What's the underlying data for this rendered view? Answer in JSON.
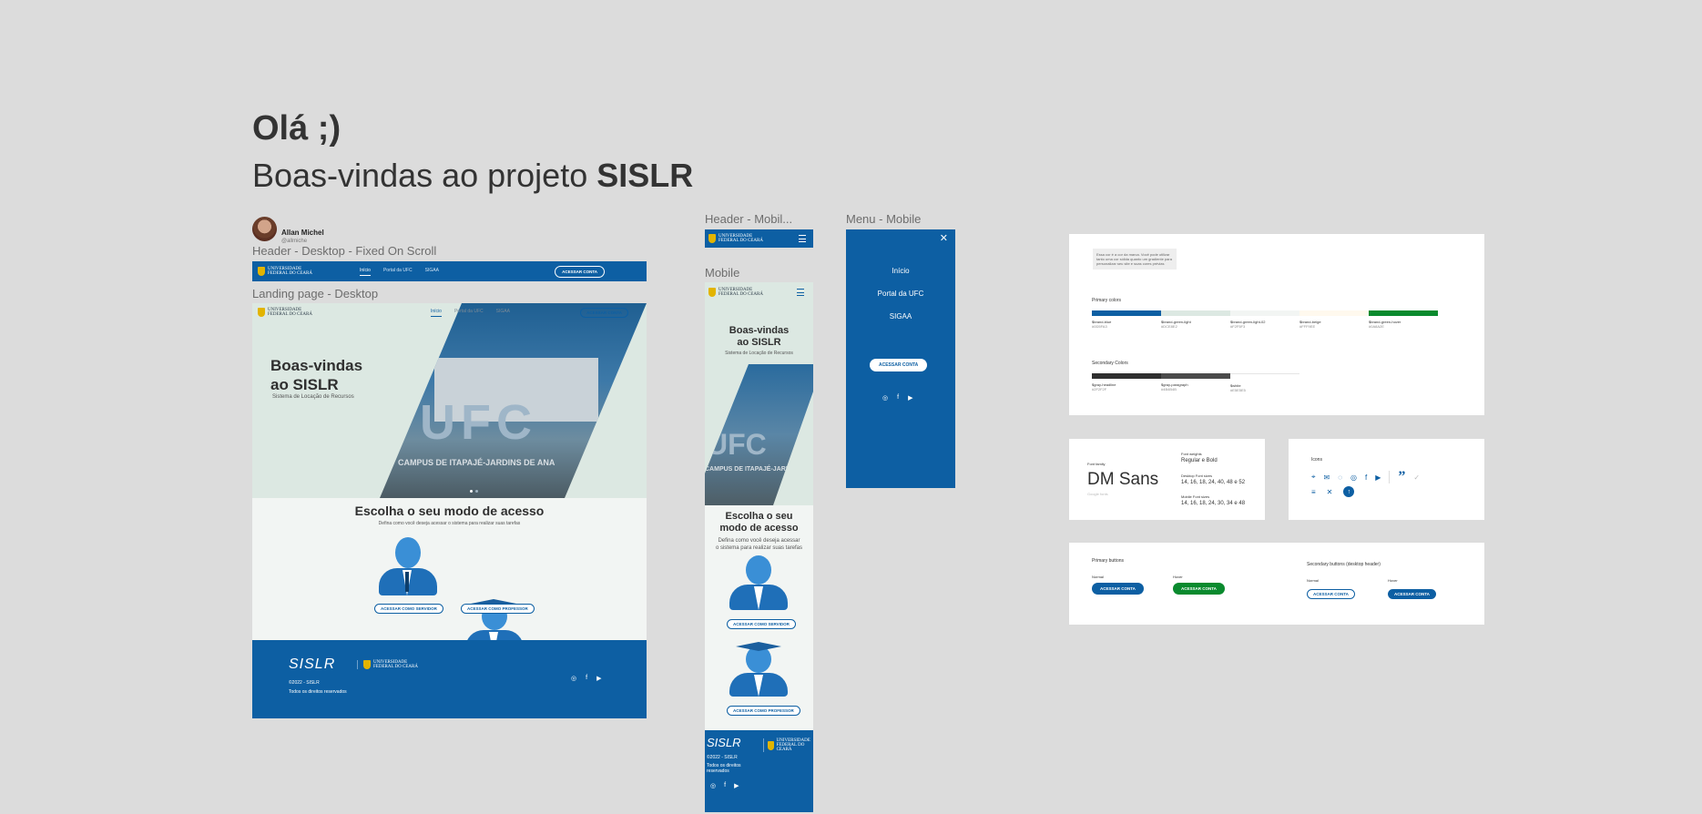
{
  "intro": {
    "greeting": "Olá ;)",
    "welcome_prefix": "Boas-vindas ao projeto ",
    "welcome_bold": "SISLR"
  },
  "author": {
    "name": "Allan Michel",
    "handle": "@allmiche"
  },
  "frames": {
    "header_desktop": "Header - Desktop - Fixed On Scroll",
    "landing_desktop": "Landing page - Desktop",
    "header_mobile": "Header - Mobil...",
    "mobile": "Mobile",
    "menu_mobile": "Menu - Mobile"
  },
  "logo": {
    "line1": "Universidade",
    "line2": "Federal do Ceará"
  },
  "nav": {
    "inicio": "Início",
    "portal": "Portal da UFC",
    "sigaa": "SIGAA",
    "acessar": "ACESSAR CONTA"
  },
  "hero": {
    "title_line1": "Boas-vindas",
    "title_line2": "ao SISLR",
    "subtitle": "Sistema de Locação de Recursos",
    "photo_text": "UFC",
    "campus_text": "CAMPUS DE ITAPAJÉ-JARDINS DE ANA"
  },
  "access": {
    "title": "Escolha o seu modo de acesso",
    "mobile_title_line1": "Escolha o seu",
    "mobile_title_line2": "modo de acesso",
    "subtitle": "Defina como você deseja acessar o sistema para realizar suas tarefas",
    "mobile_subtitle_line1": "Defina como você deseja acessar",
    "mobile_subtitle_line2": "o sistema para realizar suas tarefas",
    "servidor_btn": "ACESSAR COMO SERVIDOR",
    "professor_btn": "ACESSAR COMO PROFESSOR"
  },
  "footer": {
    "brand": "SISLR",
    "copyright": "©2022 - SISLR",
    "rights": "Todos os direitos reservados",
    "rights_line1": "Todos os direitos",
    "rights_line2": "reservados"
  },
  "menu_mobile": {
    "items": [
      "Início",
      "Portal da UFC",
      "SIGAA"
    ],
    "button": "ACESSAR CONTA"
  },
  "colors_card": {
    "note": "Essa cor é a cor da marca. Você pode utilizar tanto uma cor sólida quanto um gradiente para personalizar seu site e suas cores prévias",
    "primary_title": "Primary colors",
    "primary": [
      {
        "name": "$brand-blue",
        "hex": "#0D5FA3"
      },
      {
        "name": "$brand-green-light",
        "hex": "#DCE8E2"
      },
      {
        "name": "$brand-green-light-02",
        "hex": "#F2F5F3"
      },
      {
        "name": "$brand-beige",
        "hex": "#FFF9EE"
      },
      {
        "name": "$brand-green-hover",
        "hex": "#0A8A2E"
      }
    ],
    "secondary_title": "Secondary Colors",
    "secondary": [
      {
        "name": "$gray-headline",
        "hex": "#2F2F2F"
      },
      {
        "name": "$gray-paragraph",
        "hex": "#4B4B4B"
      },
      {
        "name": "$white",
        "hex": "#E5E5E5"
      }
    ]
  },
  "typography": {
    "family_label": "Font family",
    "family": "DM Sans",
    "family_note": "Google fonts",
    "weights_label": "Font weights",
    "weights": "Regular e Bold",
    "desktop_label": "Desktop Font sizes",
    "desktop_sizes": "14, 16, 18, 24, 40, 48 e 52",
    "mobile_label": "Mobile Font sizes",
    "mobile_sizes": "14, 16, 18, 24, 30, 34 e 48"
  },
  "icons_card": {
    "title": "Icons",
    "icons": [
      "location-icon",
      "mail-icon",
      "whatsapp-icon",
      "instagram-icon",
      "facebook-icon",
      "youtube-icon",
      "quote-icon",
      "check-icon",
      "menu-icon",
      "close-icon",
      "arrow-up-icon"
    ]
  },
  "buttons_card": {
    "primary_title": "Primary buttons",
    "secondary_title": "Secondary buttons (desktop header)",
    "normal": "Normal",
    "hover": "Hover",
    "label": "ACESSAR CONTA"
  }
}
